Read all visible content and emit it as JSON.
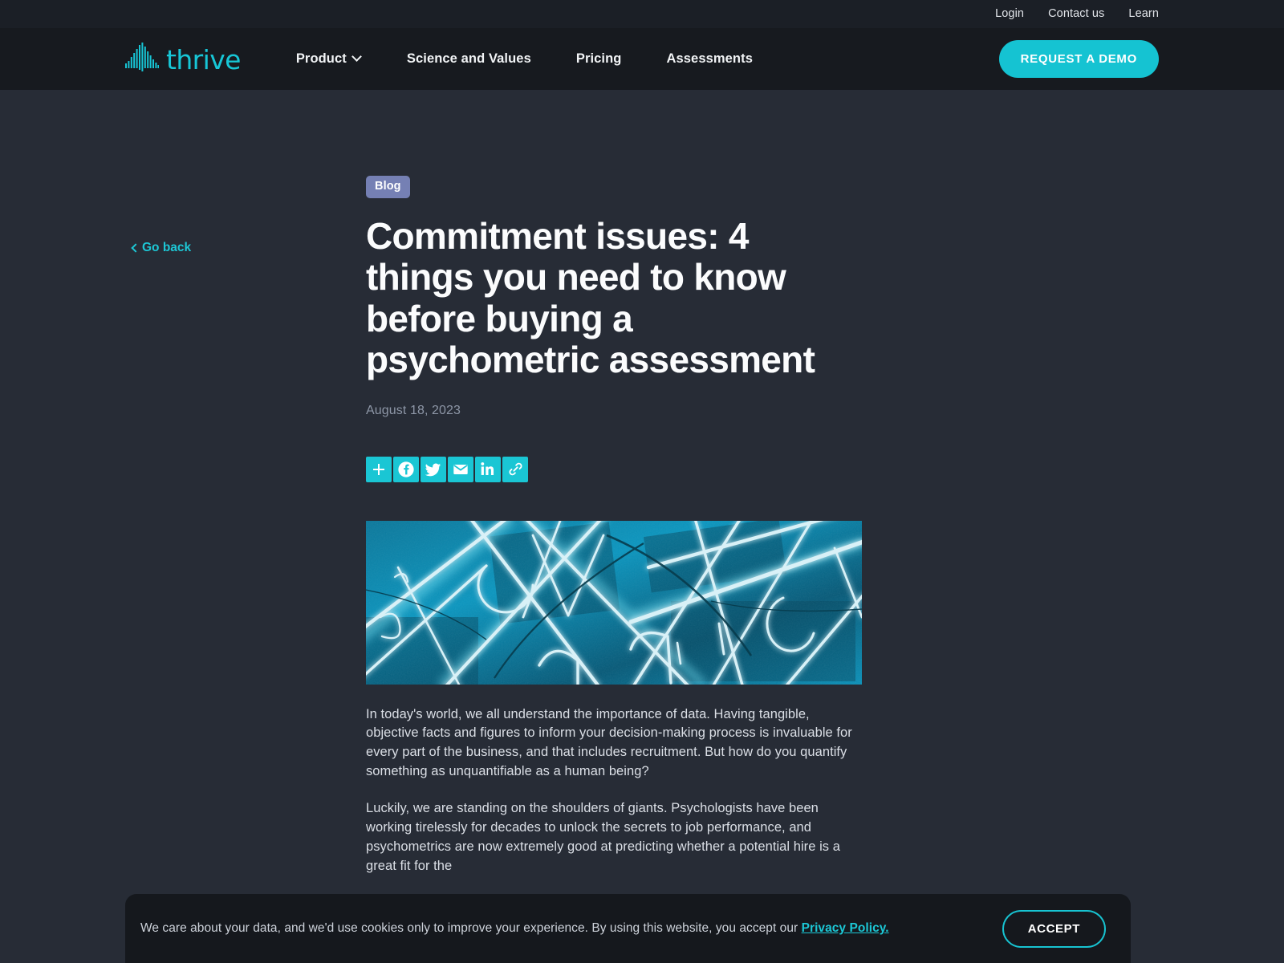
{
  "colors": {
    "accent": "#17c6d6",
    "page_bg": "#272c36",
    "nav_bg": "#171a1f",
    "utility_bg": "#1b1f26",
    "badge_bg": "#7580b4",
    "banner_bg": "#15181d",
    "heading": "#fbfcfd",
    "muted_text": "#8d96a6"
  },
  "utility_nav": {
    "items": [
      {
        "label": "Login",
        "name": "utility-link-login"
      },
      {
        "label": "Contact us",
        "name": "utility-link-contact-us"
      },
      {
        "label": "Learn",
        "name": "utility-link-learn"
      }
    ]
  },
  "nav": {
    "brand": {
      "word": "thrive",
      "icon": "waveform-bars-logo"
    },
    "items": [
      {
        "label": "Product",
        "has_dropdown": true,
        "icon": "chevron-down-icon"
      },
      {
        "label": "Science and Values",
        "has_dropdown": false
      },
      {
        "label": "Pricing",
        "has_dropdown": false
      },
      {
        "label": "Assessments",
        "has_dropdown": false
      }
    ],
    "cta_label": "REQUEST A DEMO"
  },
  "sidebar": {
    "go_back_label": "Go back",
    "go_back_icon": "chevron-left-icon"
  },
  "article": {
    "category_badge": "Blog",
    "title": "Commitment issues: 4 things you need to know before buying a psychometric assessment",
    "date": "August 18, 2023",
    "hero_image_alt": "Abstract photograph of bright cyan neon light tubes crossing at many angles",
    "paragraphs": [
      "In today's world, we all understand the importance of data. Having tangible, objective facts and figures to inform your decision-making process is invaluable for every part of the business, and that includes recruitment. But how do you quantify something as unquantifiable as a human being?",
      "Luckily, we are standing on the shoulders of giants. Psychologists have been working tirelessly for decades to unlock the secrets to job performance, and psychometrics are now extremely good at predicting whether a potential hire is a great fit for the"
    ]
  },
  "share": {
    "buttons": [
      {
        "label": "Share",
        "icon": "plus-share-icon"
      },
      {
        "label": "Facebook",
        "icon": "facebook-icon"
      },
      {
        "label": "Twitter",
        "icon": "twitter-icon"
      },
      {
        "label": "Email",
        "icon": "email-icon"
      },
      {
        "label": "LinkedIn",
        "icon": "linkedin-icon"
      },
      {
        "label": "Copy Link",
        "icon": "copy-link-icon"
      }
    ]
  },
  "cookie_banner": {
    "text_before": "We care about your data, and we'd use cookies only to improve your experience. By using this website, you accept our ",
    "link_label": "Privacy Policy.",
    "accept_label": "ACCEPT"
  }
}
